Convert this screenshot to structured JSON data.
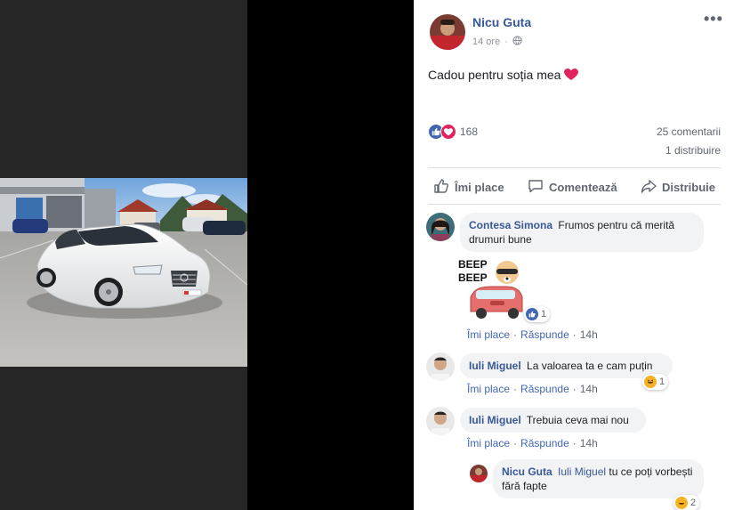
{
  "post": {
    "author": "Nicu Guta",
    "time": "14 ore",
    "privacy_icon": "globe-icon",
    "text": "Cadou pentru soția mea",
    "text_emoji": "❤️",
    "reaction_count": "168",
    "comments": "25 comentarii",
    "shares": "1 distribuire"
  },
  "actions": {
    "like": "Îmi place",
    "comment": "Comentează",
    "share": "Distribuie"
  },
  "comments": [
    {
      "author": "Contesa Simona",
      "text": "Frumos pentru că merită drumuri bune",
      "sticker_text": "BEEP BEEP",
      "sticker_reaction_count": "1",
      "like_label": "Îmi place",
      "reply_label": "Răspunde",
      "time": "14h"
    },
    {
      "author": "Iuli Miguel",
      "text": "La valoarea ta e cam puțin",
      "reaction_count": "1",
      "like_label": "Îmi place",
      "reply_label": "Răspunde",
      "time": "14h"
    },
    {
      "author": "Iuli Miguel",
      "text": "Trebuia ceva mai nou",
      "like_label": "Îmi place",
      "reply_label": "Răspunde",
      "time": "14h"
    },
    {
      "author": "Nicu Guta",
      "mention": "Iuli Miguel",
      "text": "tu ce poți vorbești fără fapte",
      "reaction_count": "2"
    }
  ],
  "colors": {
    "link": "#385898",
    "like_blue": "#4267b2",
    "love_red": "#e0245e",
    "bubble": "#f2f3f5"
  }
}
